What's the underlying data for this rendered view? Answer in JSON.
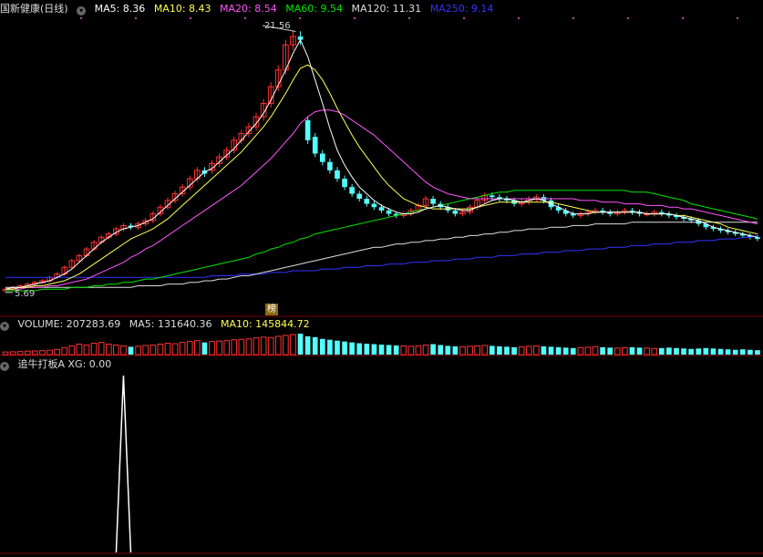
{
  "header": {
    "stock_name": "国新健康(日线)",
    "ma5": "MA5: 8.36",
    "ma10": "MA10: 8.43",
    "ma20": "MA20: 8.54",
    "ma60": "MA60: 9.54",
    "ma120": "MA120: 11.31",
    "ma250": "MA250: 9.14"
  },
  "volume_header": {
    "volume": "VOLUME: 207283.69",
    "ma5": "MA5: 131640.36",
    "ma10": "MA10: 145844.72"
  },
  "indicator_header": {
    "label": "追牛打板A XG: 0.00"
  },
  "badge_label": "榜",
  "colors": {
    "up": "#ff3232",
    "down": "#54ffff",
    "ma5": "#ffffff",
    "ma10": "#ffff54",
    "ma20": "#ff54ff",
    "ma60": "#00e600",
    "ma120": "#dddddd",
    "ma250": "#3333ff",
    "xg": "#ffffff",
    "axis": "#800000"
  },
  "chart_data": {
    "type": "candlestick",
    "annotations": {
      "high": "21.56",
      "low": "5.69"
    },
    "price": {
      "open": [
        5.8,
        5.9,
        6.0,
        6.1,
        6.2,
        6.3,
        6.4,
        6.6,
        6.8,
        7.2,
        7.6,
        7.9,
        8.3,
        8.7,
        9.0,
        9.2,
        9.5,
        9.7,
        9.6,
        9.8,
        10.0,
        10.4,
        10.8,
        11.2,
        11.6,
        12.0,
        12.5,
        13.0,
        13.0,
        13.4,
        13.8,
        14.2,
        14.8,
        15.2,
        15.6,
        16.2,
        17.0,
        18.0,
        19.0,
        20.5,
        21.0,
        16.0,
        15.0,
        14.0,
        13.5,
        13.0,
        12.5,
        12.0,
        11.6,
        11.3,
        11.0,
        10.8,
        10.6,
        10.4,
        10.3,
        10.4,
        10.6,
        10.9,
        11.3,
        11.0,
        10.8,
        10.6,
        10.4,
        10.5,
        10.8,
        11.2,
        11.5,
        11.4,
        11.3,
        11.2,
        11.0,
        11.1,
        11.3,
        11.4,
        11.2,
        10.8,
        10.6,
        10.4,
        10.3,
        10.4,
        10.5,
        10.6,
        10.5,
        10.4,
        10.5,
        10.6,
        10.5,
        10.4,
        10.4,
        10.5,
        10.4,
        10.3,
        10.2,
        10.1,
        10.0,
        9.8,
        9.6,
        9.5,
        9.4,
        9.3,
        9.2,
        9.1,
        9.0
      ],
      "close": [
        5.9,
        6.0,
        6.1,
        6.2,
        6.3,
        6.4,
        6.6,
        6.8,
        7.2,
        7.6,
        7.9,
        8.3,
        8.7,
        9.0,
        9.2,
        9.5,
        9.7,
        9.6,
        9.8,
        10.0,
        10.4,
        10.8,
        11.2,
        11.6,
        12.0,
        12.5,
        13.0,
        12.8,
        13.4,
        13.8,
        14.2,
        14.8,
        15.2,
        15.6,
        16.2,
        17.0,
        18.0,
        19.0,
        20.5,
        21.0,
        20.8,
        14.8,
        14.0,
        13.5,
        13.0,
        12.5,
        12.0,
        11.6,
        11.3,
        11.0,
        10.8,
        10.6,
        10.4,
        10.3,
        10.4,
        10.6,
        10.9,
        11.3,
        11.0,
        10.8,
        10.6,
        10.4,
        10.5,
        10.8,
        11.2,
        11.5,
        11.4,
        11.3,
        11.2,
        11.0,
        11.1,
        11.3,
        11.4,
        11.2,
        10.8,
        10.6,
        10.4,
        10.3,
        10.4,
        10.5,
        10.6,
        10.5,
        10.4,
        10.5,
        10.6,
        10.5,
        10.4,
        10.4,
        10.5,
        10.4,
        10.3,
        10.2,
        10.1,
        10.0,
        9.8,
        9.6,
        9.5,
        9.4,
        9.3,
        9.2,
        9.1,
        9.0,
        8.9
      ],
      "ma5": [
        5.9,
        6.0,
        6.0,
        6.1,
        6.2,
        6.3,
        6.4,
        6.6,
        6.8,
        7.1,
        7.5,
        7.9,
        8.3,
        8.7,
        9.0,
        9.3,
        9.5,
        9.6,
        9.7,
        9.9,
        10.1,
        10.5,
        10.9,
        11.3,
        11.7,
        12.1,
        12.5,
        12.9,
        13.1,
        13.5,
        13.9,
        14.3,
        14.8,
        15.3,
        15.8,
        16.4,
        17.2,
        18.1,
        19.0,
        20.0,
        20.8,
        19.8,
        18.4,
        17.0,
        15.5,
        14.2,
        13.3,
        12.6,
        12.0,
        11.6,
        11.2,
        10.9,
        10.7,
        10.5,
        10.4,
        10.4,
        10.5,
        10.7,
        10.8,
        10.9,
        10.8,
        10.7,
        10.6,
        10.6,
        10.8,
        11.0,
        11.2,
        11.3,
        11.3,
        11.2,
        11.1,
        11.2,
        11.3,
        11.2,
        11.0,
        10.8,
        10.6,
        10.4,
        10.4,
        10.4,
        10.5,
        10.5,
        10.5,
        10.5,
        10.5,
        10.5,
        10.5,
        10.4,
        10.4,
        10.4,
        10.4,
        10.3,
        10.2,
        10.1,
        10.0,
        9.8,
        9.6,
        9.5,
        9.4,
        9.3,
        9.2,
        9.1,
        9.0
      ],
      "ma10": [
        5.9,
        5.9,
        6.0,
        6.0,
        6.1,
        6.1,
        6.2,
        6.3,
        6.4,
        6.6,
        6.8,
        7.1,
        7.4,
        7.7,
        8.0,
        8.3,
        8.6,
        8.9,
        9.1,
        9.3,
        9.5,
        9.8,
        10.1,
        10.5,
        10.9,
        11.3,
        11.7,
        12.1,
        12.5,
        12.9,
        13.3,
        13.7,
        14.1,
        14.6,
        15.1,
        15.6,
        16.2,
        16.9,
        17.6,
        18.4,
        19.1,
        19.3,
        19.0,
        18.4,
        17.6,
        16.7,
        15.9,
        15.1,
        14.4,
        13.8,
        13.2,
        12.6,
        12.1,
        11.7,
        11.3,
        11.1,
        10.9,
        10.8,
        10.7,
        10.7,
        10.7,
        10.7,
        10.7,
        10.7,
        10.8,
        10.9,
        11.0,
        11.1,
        11.1,
        11.1,
        11.1,
        11.1,
        11.1,
        11.1,
        11.1,
        11.0,
        10.9,
        10.8,
        10.7,
        10.6,
        10.5,
        10.5,
        10.5,
        10.5,
        10.5,
        10.5,
        10.5,
        10.4,
        10.4,
        10.4,
        10.4,
        10.3,
        10.3,
        10.2,
        10.1,
        10.0,
        9.9,
        9.8,
        9.6,
        9.5,
        9.4,
        9.3,
        9.2
      ],
      "ma20": [
        5.9,
        5.9,
        5.9,
        6.0,
        6.0,
        6.0,
        6.1,
        6.1,
        6.2,
        6.3,
        6.4,
        6.5,
        6.7,
        6.9,
        7.1,
        7.3,
        7.5,
        7.8,
        8.0,
        8.3,
        8.5,
        8.8,
        9.1,
        9.4,
        9.7,
        10.0,
        10.3,
        10.6,
        10.9,
        11.2,
        11.5,
        11.8,
        12.1,
        12.5,
        12.9,
        13.3,
        13.7,
        14.2,
        14.7,
        15.2,
        15.8,
        16.2,
        16.5,
        16.6,
        16.6,
        16.5,
        16.3,
        16.0,
        15.7,
        15.4,
        15.1,
        14.7,
        14.3,
        13.9,
        13.5,
        13.1,
        12.7,
        12.3,
        12.0,
        11.8,
        11.6,
        11.5,
        11.4,
        11.3,
        11.3,
        11.3,
        11.3,
        11.3,
        11.3,
        11.3,
        11.3,
        11.3,
        11.3,
        11.3,
        11.3,
        11.3,
        11.3,
        11.3,
        11.2,
        11.2,
        11.2,
        11.1,
        11.1,
        11.1,
        11.0,
        11.0,
        11.0,
        10.9,
        10.9,
        10.9,
        10.8,
        10.8,
        10.7,
        10.7,
        10.6,
        10.5,
        10.4,
        10.3,
        10.2,
        10.1,
        10.0,
        9.9,
        9.8
      ],
      "ma60": [
        5.8,
        5.8,
        5.8,
        5.8,
        5.8,
        5.9,
        5.9,
        5.9,
        5.9,
        6.0,
        6.0,
        6.0,
        6.1,
        6.1,
        6.2,
        6.2,
        6.3,
        6.3,
        6.4,
        6.5,
        6.5,
        6.6,
        6.7,
        6.8,
        6.9,
        7.0,
        7.1,
        7.2,
        7.3,
        7.4,
        7.5,
        7.6,
        7.7,
        7.8,
        8.0,
        8.1,
        8.3,
        8.4,
        8.6,
        8.7,
        8.9,
        9.0,
        9.2,
        9.3,
        9.4,
        9.5,
        9.6,
        9.7,
        9.8,
        9.9,
        10.0,
        10.1,
        10.2,
        10.3,
        10.4,
        10.5,
        10.6,
        10.7,
        10.8,
        10.9,
        11.0,
        11.1,
        11.2,
        11.3,
        11.4,
        11.5,
        11.6,
        11.7,
        11.7,
        11.8,
        11.8,
        11.8,
        11.8,
        11.8,
        11.8,
        11.8,
        11.8,
        11.8,
        11.8,
        11.8,
        11.8,
        11.8,
        11.8,
        11.8,
        11.8,
        11.7,
        11.7,
        11.7,
        11.6,
        11.5,
        11.4,
        11.3,
        11.2,
        11.0,
        10.9,
        10.8,
        10.7,
        10.6,
        10.5,
        10.4,
        10.3,
        10.2,
        10.1
      ],
      "ma120": [
        6.0,
        6.0,
        6.0,
        6.0,
        6.0,
        6.0,
        6.0,
        6.0,
        6.0,
        6.0,
        6.0,
        6.0,
        6.0,
        6.0,
        6.0,
        6.0,
        6.0,
        6.0,
        6.1,
        6.1,
        6.1,
        6.1,
        6.2,
        6.2,
        6.2,
        6.3,
        6.3,
        6.4,
        6.4,
        6.5,
        6.5,
        6.6,
        6.7,
        6.7,
        6.8,
        6.9,
        7.0,
        7.1,
        7.2,
        7.3,
        7.4,
        7.5,
        7.6,
        7.7,
        7.8,
        7.9,
        8.0,
        8.1,
        8.2,
        8.3,
        8.4,
        8.4,
        8.5,
        8.6,
        8.6,
        8.7,
        8.7,
        8.8,
        8.8,
        8.9,
        8.9,
        9.0,
        9.0,
        9.1,
        9.1,
        9.2,
        9.2,
        9.3,
        9.3,
        9.4,
        9.4,
        9.5,
        9.5,
        9.5,
        9.6,
        9.6,
        9.6,
        9.7,
        9.7,
        9.7,
        9.8,
        9.8,
        9.8,
        9.8,
        9.8,
        9.9,
        9.9,
        9.9,
        9.9,
        9.9,
        9.9,
        9.9,
        9.9,
        9.9,
        9.9,
        9.9,
        9.9,
        9.9,
        9.9,
        9.9,
        9.9,
        9.9,
        9.9
      ],
      "ma250": [
        6.6,
        6.6,
        6.6,
        6.6,
        6.6,
        6.6,
        6.6,
        6.6,
        6.6,
        6.6,
        6.6,
        6.6,
        6.6,
        6.6,
        6.6,
        6.6,
        6.6,
        6.6,
        6.6,
        6.6,
        6.6,
        6.6,
        6.6,
        6.6,
        6.6,
        6.6,
        6.6,
        6.6,
        6.7,
        6.7,
        6.7,
        6.7,
        6.8,
        6.8,
        6.8,
        6.8,
        6.9,
        6.9,
        6.9,
        7.0,
        7.0,
        7.0,
        7.0,
        7.1,
        7.1,
        7.1,
        7.2,
        7.2,
        7.2,
        7.3,
        7.3,
        7.3,
        7.4,
        7.4,
        7.4,
        7.5,
        7.5,
        7.5,
        7.6,
        7.6,
        7.6,
        7.7,
        7.7,
        7.7,
        7.8,
        7.8,
        7.8,
        7.9,
        7.9,
        7.9,
        8.0,
        8.0,
        8.0,
        8.1,
        8.1,
        8.1,
        8.2,
        8.2,
        8.2,
        8.3,
        8.3,
        8.3,
        8.4,
        8.4,
        8.4,
        8.5,
        8.5,
        8.5,
        8.6,
        8.6,
        8.6,
        8.7,
        8.7,
        8.7,
        8.8,
        8.8,
        8.8,
        8.9,
        8.9,
        8.9,
        9.0,
        9.0,
        9.1
      ]
    },
    "volume": [
      30,
      32,
      35,
      40,
      42,
      45,
      50,
      60,
      80,
      100,
      120,
      110,
      130,
      140,
      120,
      110,
      100,
      90,
      95,
      105,
      110,
      120,
      130,
      125,
      140,
      150,
      160,
      140,
      150,
      155,
      160,
      170,
      175,
      180,
      190,
      200,
      195,
      210,
      220,
      230,
      240,
      210,
      200,
      180,
      170,
      160,
      150,
      140,
      130,
      125,
      120,
      115,
      110,
      105,
      100,
      95,
      100,
      110,
      120,
      110,
      100,
      95,
      90,
      95,
      100,
      105,
      100,
      95,
      90,
      85,
      90,
      95,
      100,
      95,
      90,
      85,
      80,
      75,
      80,
      85,
      90,
      85,
      80,
      75,
      80,
      85,
      80,
      75,
      70,
      75,
      80,
      75,
      70,
      65,
      70,
      75,
      70,
      65,
      60,
      55,
      60,
      55,
      50
    ],
    "xg_signal_index": 16
  }
}
